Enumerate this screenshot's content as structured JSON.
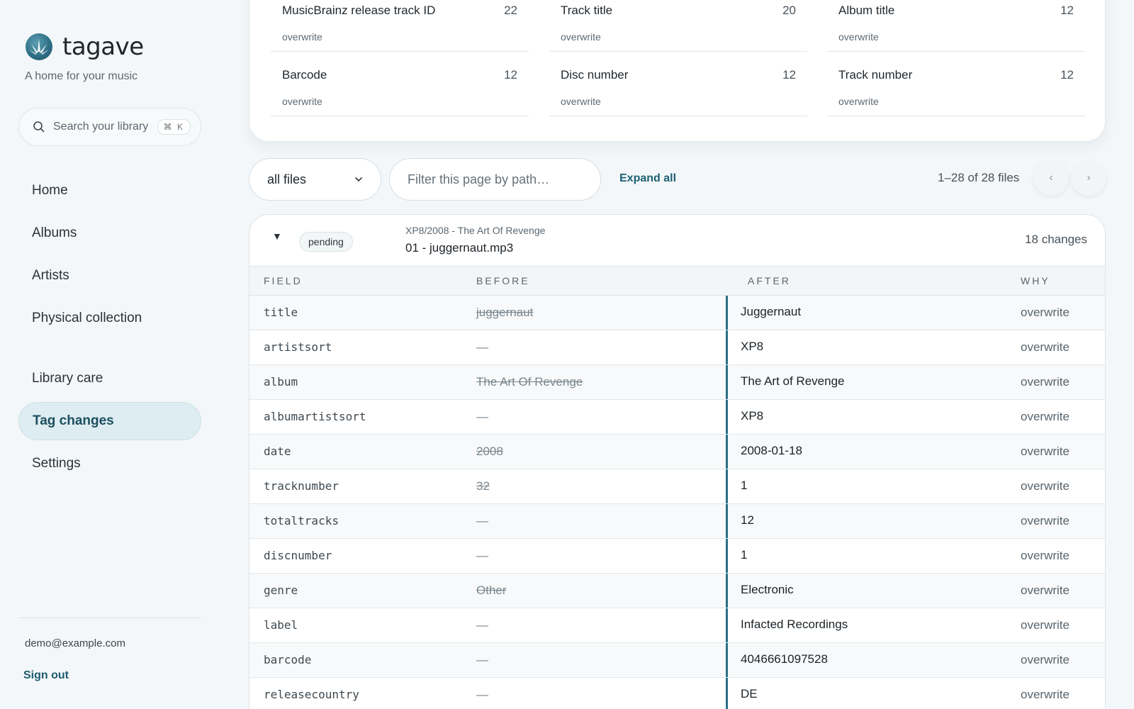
{
  "brand": {
    "name": "tagave",
    "tagline": "A home for your music"
  },
  "search": {
    "placeholder": "Search your library",
    "shortcut": "⌘ K"
  },
  "nav": {
    "items": [
      {
        "label": "Home",
        "active": false
      },
      {
        "label": "Albums",
        "active": false
      },
      {
        "label": "Artists",
        "active": false
      },
      {
        "label": "Physical collection",
        "active": false
      },
      {
        "label": "Library care",
        "active": false
      },
      {
        "label": "Tag changes",
        "active": true
      },
      {
        "label": "Settings",
        "active": false
      }
    ]
  },
  "account": {
    "email": "demo@example.com",
    "sign_out": "Sign out"
  },
  "summary": {
    "cells": [
      {
        "name": "MusicBrainz release track ID",
        "count": "22",
        "rule": "overwrite"
      },
      {
        "name": "Track title",
        "count": "20",
        "rule": "overwrite"
      },
      {
        "name": "Album title",
        "count": "12",
        "rule": "overwrite"
      },
      {
        "name": "Barcode",
        "count": "12",
        "rule": "overwrite"
      },
      {
        "name": "Disc number",
        "count": "12",
        "rule": "overwrite"
      },
      {
        "name": "Track number",
        "count": "12",
        "rule": "overwrite"
      }
    ]
  },
  "toolbar": {
    "select_value": "all files",
    "filter_placeholder": "Filter this page by path…",
    "expand_all": "Expand all",
    "pager_text": "1–28 of 28 files",
    "prev": "‹",
    "next": "›"
  },
  "file": {
    "toggle": "▼",
    "status": "pending",
    "folder": "XP8/2008 - The Art Of Revenge",
    "filename": "01 - juggernaut.mp3",
    "changes": "18 changes",
    "columns": {
      "field": "FIELD",
      "before": "BEFORE",
      "after": "AFTER",
      "why": "WHY"
    },
    "rows": [
      {
        "field": "title",
        "before": "juggernaut",
        "after": "Juggernaut",
        "why": "overwrite",
        "struck": true
      },
      {
        "field": "artistsort",
        "before": "—",
        "after": "XP8",
        "why": "overwrite",
        "struck": false
      },
      {
        "field": "album",
        "before": "The Art Of Revenge",
        "after": "The Art of Revenge",
        "why": "overwrite",
        "struck": true
      },
      {
        "field": "albumartistsort",
        "before": "—",
        "after": "XP8",
        "why": "overwrite",
        "struck": false
      },
      {
        "field": "date",
        "before": "2008",
        "after": "2008-01-18",
        "why": "overwrite",
        "struck": true
      },
      {
        "field": "tracknumber",
        "before": "32",
        "after": "1",
        "why": "overwrite",
        "struck": true
      },
      {
        "field": "totaltracks",
        "before": "—",
        "after": "12",
        "why": "overwrite",
        "struck": false
      },
      {
        "field": "discnumber",
        "before": "—",
        "after": "1",
        "why": "overwrite",
        "struck": false
      },
      {
        "field": "genre",
        "before": "Other",
        "after": "Electronic",
        "why": "overwrite",
        "struck": true
      },
      {
        "field": "label",
        "before": "—",
        "after": "Infacted Recordings",
        "why": "overwrite",
        "struck": false
      },
      {
        "field": "barcode",
        "before": "—",
        "after": "4046661097528",
        "why": "overwrite",
        "struck": false
      },
      {
        "field": "releasecountry",
        "before": "—",
        "after": "DE",
        "why": "overwrite",
        "struck": false
      }
    ]
  },
  "colors": {
    "accent": "#1d5f73",
    "active_nav_bg": "#deedf1",
    "after_border": "#2a6f86"
  }
}
